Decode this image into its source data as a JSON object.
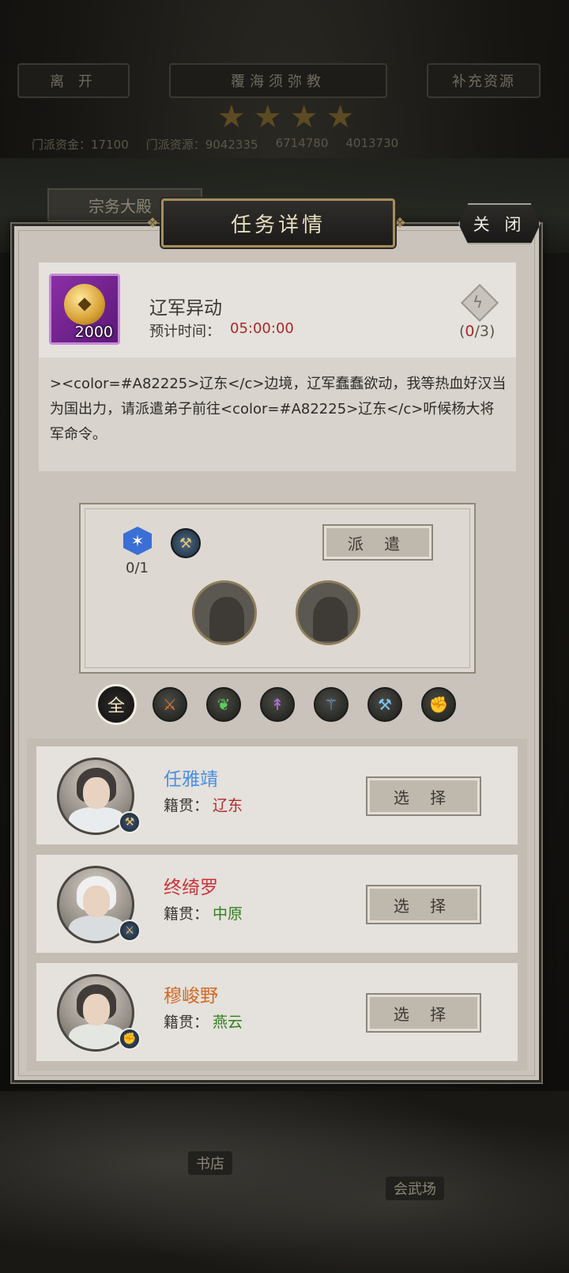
{
  "header": {
    "leave_label": "离 开",
    "sect_name": "覆海须弥教",
    "supply_label": "补充资源",
    "stars": 4,
    "funds_label": "门派资金：",
    "funds_value": "17100",
    "resources_label": "门派资源：",
    "res1": "9042335",
    "res2": "6714780",
    "res3": "4013730",
    "hall_tab": "宗务大殿"
  },
  "dialog": {
    "title": "任务详情",
    "close_label": "关 闭"
  },
  "task": {
    "reward_amount": "2000",
    "name": "辽军异动",
    "eta_label": "预计时间：",
    "eta_value": "05:00:00",
    "progress_open": "(",
    "progress_current": "0",
    "progress_rest": "/3)",
    "description": "><color=#A82225>辽东</c>边境，辽军蠢蠢欲动，我等热血好汉当为国出力，请派遣弟子前往<color=#A82225>辽东</c>听候杨大将军命令。"
  },
  "dispatch": {
    "required_count": "0/1",
    "dispatch_label": "派 遣"
  },
  "filters": {
    "all_label": "全",
    "icons": [
      "sword-class-icon",
      "leaf-blade-class-icon",
      "spear-class-icon",
      "staff-class-icon",
      "hammer-class-icon",
      "fist-class-icon"
    ]
  },
  "disciples": [
    {
      "name": "任雅靖",
      "name_color": "#4a8fe0",
      "origin_label": "籍贯：",
      "origin": "辽东",
      "origin_color": "#b02a2a",
      "select_label": "选 择"
    },
    {
      "name": "终绮罗",
      "name_color": "#c8323a",
      "origin_label": "籍贯：",
      "origin": "中原",
      "origin_color": "#2f7f1e",
      "select_label": "选 择"
    },
    {
      "name": "穆峻野",
      "name_color": "#d06a22",
      "origin_label": "籍贯：",
      "origin": "燕云",
      "origin_color": "#2f7f1e",
      "select_label": "选 择"
    }
  ],
  "background": {
    "bookstore_label": "书店",
    "arena_label": "会武场"
  }
}
